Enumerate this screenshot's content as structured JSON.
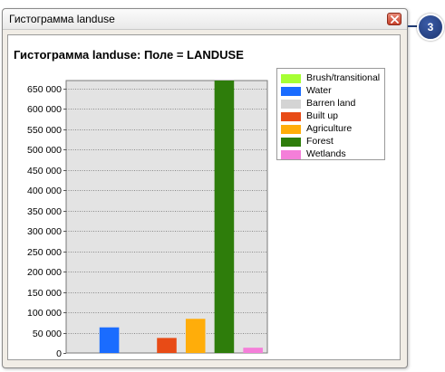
{
  "window": {
    "title": "Гистограмма landuse",
    "close_icon": "close-icon"
  },
  "callout": {
    "label": "3"
  },
  "chart_data": {
    "type": "bar",
    "title": "Гистограмма landuse: Поле = LANDUSE",
    "xlabel": "",
    "ylabel": "",
    "ylim": [
      0,
      670000
    ],
    "grid": true,
    "legend_placement": "right",
    "ytick_labels": [
      "0",
      "50 000",
      "100 000",
      "150 000",
      "200 000",
      "250 000",
      "300 000",
      "350 000",
      "400 000",
      "450 000",
      "500 000",
      "550 000",
      "600 000",
      "650 000"
    ],
    "ytick_values": [
      0,
      50000,
      100000,
      150000,
      200000,
      250000,
      300000,
      350000,
      400000,
      450000,
      500000,
      550000,
      600000,
      650000
    ],
    "categories": [
      "Brush/transitional",
      "Water",
      "Barren land",
      "Built up",
      "Agriculture",
      "Forest",
      "Wetlands"
    ],
    "values": [
      0,
      63000,
      0,
      37000,
      84000,
      670000,
      13000
    ],
    "colors": [
      "#a6ff33",
      "#1a6cff",
      "#d4d4d4",
      "#e84b16",
      "#ffad0a",
      "#2e7d0b",
      "#f47fd9"
    ]
  }
}
